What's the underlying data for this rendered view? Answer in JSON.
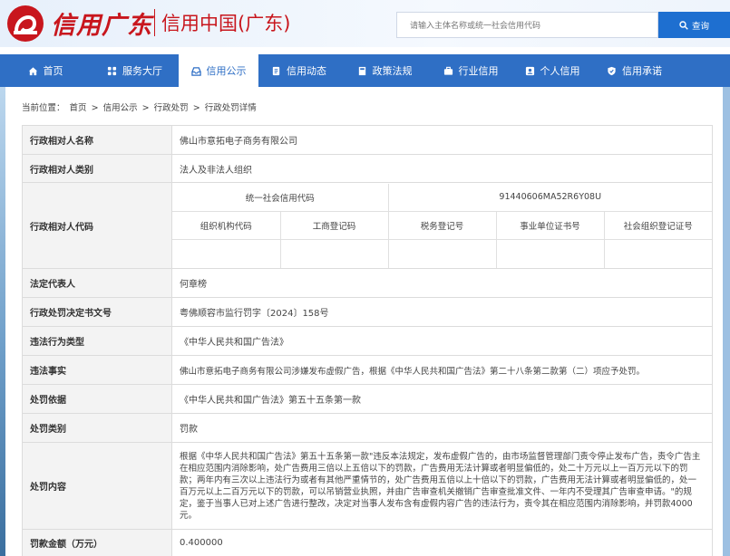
{
  "header": {
    "brand_calligraphy": "信用广东",
    "brand_main": "信用中国(广东)",
    "search_placeholder": "请输入主体名称或统一社会信用代码",
    "search_button": "查询"
  },
  "nav": {
    "items": [
      {
        "label": "首页",
        "icon": "home-icon"
      },
      {
        "label": "服务大厅",
        "icon": "grid-icon"
      },
      {
        "label": "信用公示",
        "icon": "inbox-icon",
        "active": true
      },
      {
        "label": "信用动态",
        "icon": "document-icon"
      },
      {
        "label": "政策法规",
        "icon": "book-icon"
      },
      {
        "label": "行业信用",
        "icon": "briefcase-icon"
      },
      {
        "label": "个人信用",
        "icon": "person-icon"
      },
      {
        "label": "信用承诺",
        "icon": "shield-icon"
      }
    ]
  },
  "breadcrumb": {
    "prefix": "当前位置：",
    "items": [
      "首页",
      "信用公示",
      "行政处罚",
      "行政处罚详情"
    ],
    "sep": ">"
  },
  "detail": {
    "name_label": "行政相对人名称",
    "name_value": "佛山市意拓电子商务有限公司",
    "type_label": "行政相对人类别",
    "type_value": "法人及非法人组织",
    "code_label": "行政相对人代码",
    "uscc_label": "统一社会信用代码",
    "uscc_value": "91440606MA52R6Y08U",
    "code_headers": [
      "组织机构代码",
      "工商登记码",
      "税务登记号",
      "事业单位证书号",
      "社会组织登记证号"
    ],
    "legal_label": "法定代表人",
    "legal_value": "何章榜",
    "doc_label": "行政处罚决定书文号",
    "doc_value": "粤佛顺容市监行罚字〔2024〕158号",
    "violation_type_label": "违法行为类型",
    "violation_type_value": "《中华人民共和国广告法》",
    "facts_label": "违法事实",
    "facts_value": "佛山市意拓电子商务有限公司涉嫌发布虚假广告，根据《中华人民共和国广告法》第二十八条第二款第（二）项应予处罚。",
    "basis_label": "处罚依据",
    "basis_value": "《中华人民共和国广告法》第五十五条第一款",
    "category_label": "处罚类别",
    "category_value": "罚款",
    "content_label": "处罚内容",
    "content_value": "根据《中华人民共和国广告法》第五十五条第一款\"违反本法规定，发布虚假广告的，由市场监督管理部门责令停止发布广告，责令广告主在相应范围内消除影响，处广告费用三倍以上五倍以下的罚款，广告费用无法计算或者明显偏低的，处二十万元以上一百万元以下的罚款；两年内有三次以上违法行为或者有其他严重情节的，处广告费用五倍以上十倍以下的罚款，广告费用无法计算或者明显偏低的，处一百万元以上二百万元以下的罚款，可以吊销营业执照，并由广告审查机关撤销广告审查批准文件、一年内不受理其广告审查申请。\"的规定，鉴于当事人已对上述广告进行整改，决定对当事人发布含有虚假内容广告的违法行为，责令其在相应范围内消除影响，并罚款4000元。",
    "amount_label": "罚款金额（万元）",
    "amount_value": "0.400000"
  },
  "colors": {
    "brand_red": "#c8161d",
    "nav_blue": "#2f6fc5",
    "search_blue": "#1e6fd0"
  }
}
